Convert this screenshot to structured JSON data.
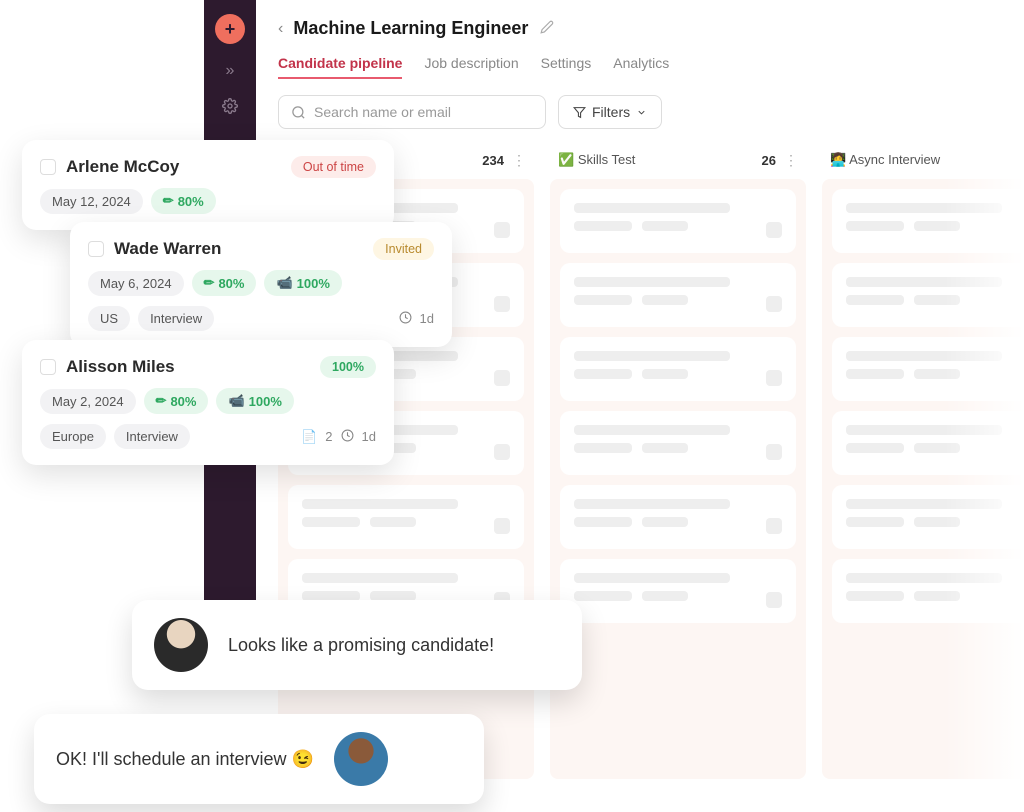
{
  "page": {
    "title": "Machine Learning Engineer"
  },
  "tabs": [
    {
      "label": "Candidate pipeline",
      "active": true
    },
    {
      "label": "Job description"
    },
    {
      "label": "Settings"
    },
    {
      "label": "Analytics"
    }
  ],
  "search": {
    "placeholder": "Search name or email"
  },
  "filters": {
    "label": "Filters"
  },
  "columns": [
    {
      "icon": "",
      "label": "",
      "count": "234"
    },
    {
      "icon": "✅",
      "label": "Skills Test",
      "count": "26"
    },
    {
      "icon": "👩‍💻",
      "label": "Async Interview",
      "count": ""
    }
  ],
  "candidates": [
    {
      "name": "Arlene McCoy",
      "status": {
        "text": "Out of time",
        "kind": "out"
      },
      "date": "May 12, 2024",
      "scores": [
        {
          "icon": "✏",
          "pct": "80%"
        }
      ]
    },
    {
      "name": "Wade Warren",
      "status": {
        "text": "Invited",
        "kind": "invited"
      },
      "date": "May 6, 2024",
      "scores": [
        {
          "icon": "✏",
          "pct": "80%"
        },
        {
          "icon": "■",
          "pct": "100%"
        }
      ],
      "tags": [
        "US",
        "Interview"
      ],
      "time": "1d"
    },
    {
      "name": "Alisson Miles",
      "status": {
        "text": "100%",
        "kind": "pct"
      },
      "date": "May 2, 2024",
      "scores": [
        {
          "icon": "✏",
          "pct": "80%"
        },
        {
          "icon": "■",
          "pct": "100%"
        }
      ],
      "tags": [
        "Europe",
        "Interview"
      ],
      "notes": "2",
      "time": "1d"
    }
  ],
  "chat": [
    {
      "text": "Looks like a promising candidate!"
    },
    {
      "text": "OK! I'll schedule an interview 😉"
    }
  ]
}
